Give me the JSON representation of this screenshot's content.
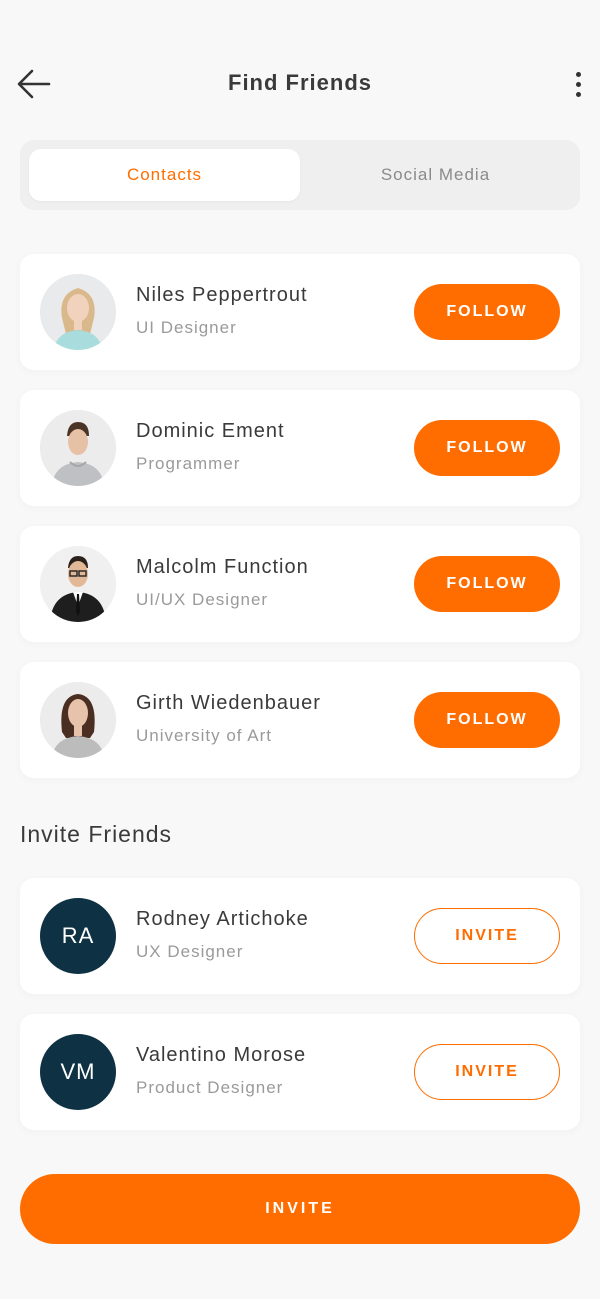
{
  "header": {
    "title": "Find Friends",
    "back_icon": "arrow-left-icon",
    "more_icon": "more-vertical-icon"
  },
  "tabs": [
    {
      "label": "Contacts",
      "active": true
    },
    {
      "label": "Social Media",
      "active": false
    }
  ],
  "contacts": [
    {
      "name": "Niles Peppertrout",
      "role": "UI Designer",
      "action": "FOLLOW"
    },
    {
      "name": "Dominic Ement",
      "role": "Programmer",
      "action": "FOLLOW"
    },
    {
      "name": "Malcolm Function",
      "role": "UI/UX Designer",
      "action": "FOLLOW"
    },
    {
      "name": "Girth Wiedenbauer",
      "role": "University of Art",
      "action": "FOLLOW"
    }
  ],
  "invite_section": {
    "title": "Invite Friends",
    "people": [
      {
        "initials": "RA",
        "name": "Rodney Artichoke",
        "role": "UX Designer",
        "action": "INVITE"
      },
      {
        "initials": "VM",
        "name": "Valentino Morose",
        "role": "Product Designer",
        "action": "INVITE"
      }
    ]
  },
  "footer": {
    "invite_label": "INVITE"
  },
  "colors": {
    "accent": "#ff6d00",
    "avatar_bg": "#0f3144",
    "background": "#f8f8f8"
  }
}
